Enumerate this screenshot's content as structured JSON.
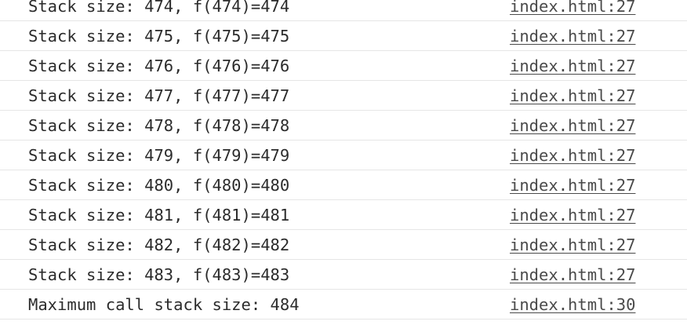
{
  "console": {
    "rows": [
      {
        "message": "Stack size: 474, f(474)=474",
        "source": "index.html:27"
      },
      {
        "message": "Stack size: 475, f(475)=475",
        "source": "index.html:27"
      },
      {
        "message": "Stack size: 476, f(476)=476",
        "source": "index.html:27"
      },
      {
        "message": "Stack size: 477, f(477)=477",
        "source": "index.html:27"
      },
      {
        "message": "Stack size: 478, f(478)=478",
        "source": "index.html:27"
      },
      {
        "message": "Stack size: 479, f(479)=479",
        "source": "index.html:27"
      },
      {
        "message": "Stack size: 480, f(480)=480",
        "source": "index.html:27"
      },
      {
        "message": "Stack size: 481, f(481)=481",
        "source": "index.html:27"
      },
      {
        "message": "Stack size: 482, f(482)=482",
        "source": "index.html:27"
      },
      {
        "message": "Stack size: 483, f(483)=483",
        "source": "index.html:27"
      },
      {
        "message": "Maximum call stack size: 484",
        "source": "index.html:30"
      }
    ]
  }
}
